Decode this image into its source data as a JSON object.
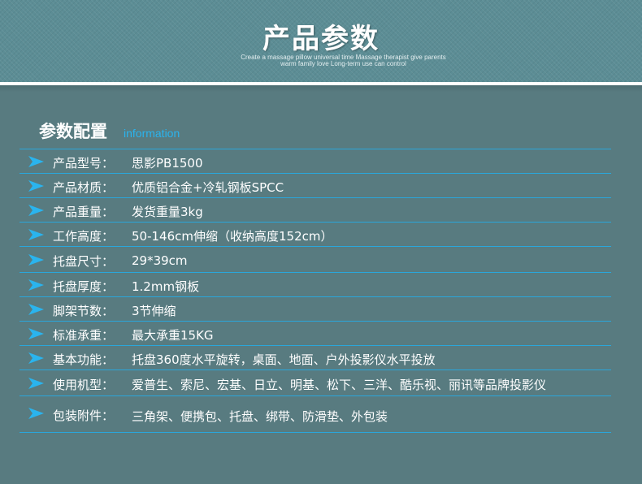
{
  "banner": {
    "title": "产品参数",
    "subtitle_line1": "Create a massage pillow universal time Massage therapist give parents",
    "subtitle_line2": "warm family love Long-term use can control"
  },
  "section": {
    "title": "参数配置",
    "title_en": "information"
  },
  "colors": {
    "accent": "#2ab4ee",
    "background": "#587b80",
    "banner": "#5c8d95"
  },
  "icons": {
    "row_marker": "arrow-icon"
  },
  "specs": [
    {
      "label": "产品型号：",
      "value": "思影PB1500"
    },
    {
      "label": "产品材质：",
      "value": "优质铝合金+冷轧钢板SPCC"
    },
    {
      "label": "产品重量：",
      "value": "发货重量3kg"
    },
    {
      "label": "工作高度：",
      "value": "50-146cm伸缩（收纳高度152cm）"
    },
    {
      "label": "托盘尺寸：",
      "value": "29*39cm"
    },
    {
      "label": "托盘厚度：",
      "value": "1.2mm钢板"
    },
    {
      "label": "脚架节数：",
      "value": "3节伸缩"
    },
    {
      "label": "标准承重：",
      "value": "最大承重15KG"
    },
    {
      "label": "基本功能：",
      "value": "托盘360度水平旋转，桌面、地面、户外投影仪水平投放"
    },
    {
      "label": "使用机型：",
      "value": "爱普生、索尼、宏基、日立、明基、松下、三洋、酷乐视、丽讯等品牌投影仪"
    },
    {
      "label": "包装附件：",
      "value": "三角架、便携包、托盘、绑带、防滑垫、外包装"
    }
  ]
}
